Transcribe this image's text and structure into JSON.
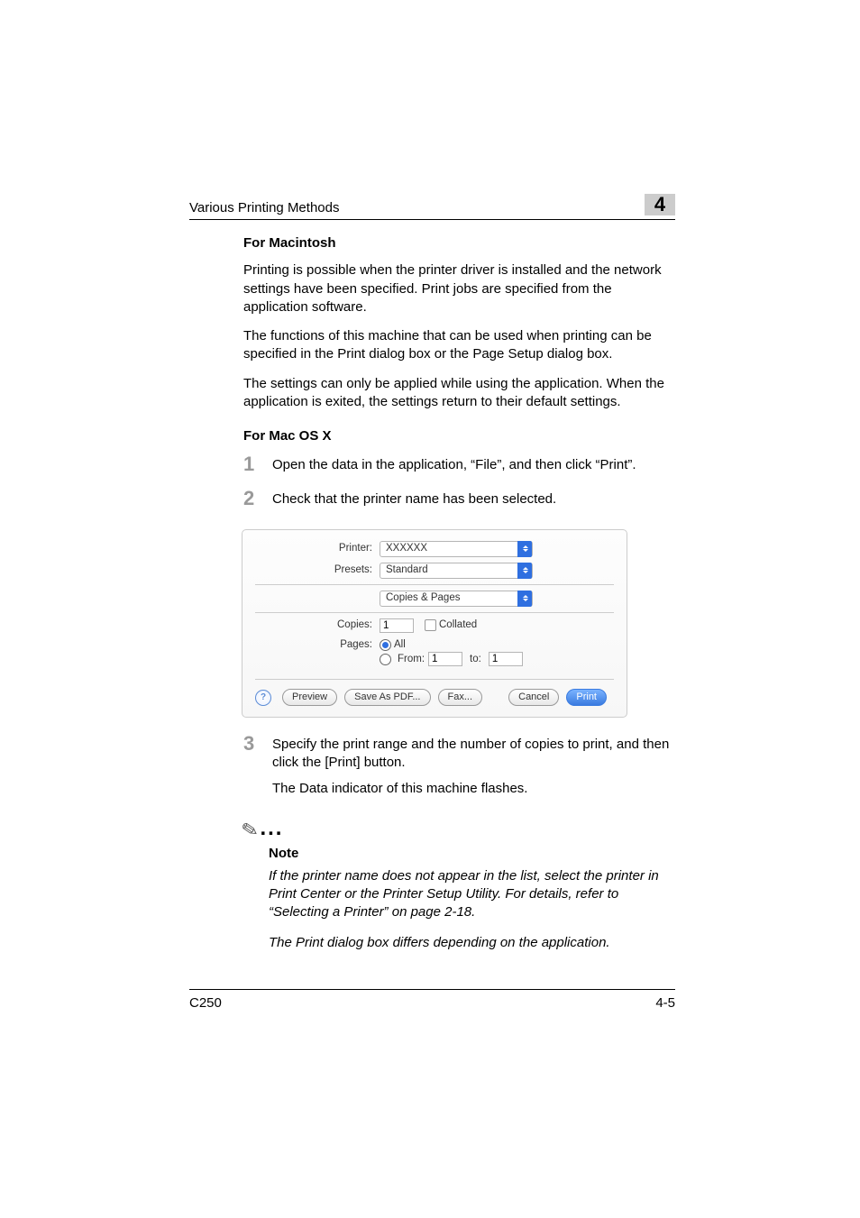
{
  "header": {
    "running_title": "Various Printing Methods",
    "chapter_number": "4"
  },
  "section_mac": {
    "heading": "For Macintosh",
    "p1": "Printing is possible when the printer driver is installed and the network settings have been specified. Print jobs are specified from the application software.",
    "p2": "The functions of this machine that can be used when printing can be specified in the Print dialog box or the Page Setup dialog box.",
    "p3": "The settings can only be applied while using the application. When the application is exited, the settings return to their default settings."
  },
  "section_osx": {
    "heading": "For Mac OS X",
    "steps": {
      "s1": {
        "num": "1",
        "text": "Open the data in the application, “File”, and then click “Print”."
      },
      "s2": {
        "num": "2",
        "text": "Check that the printer name has been selected."
      },
      "s3": {
        "num": "3",
        "text": "Specify the print range and the number of copies to print, and then click the [Print] button.",
        "sub": "The Data indicator of this machine flashes."
      }
    }
  },
  "dialog": {
    "printer_label": "Printer:",
    "printer_value": "XXXXXX",
    "presets_label": "Presets:",
    "presets_value": "Standard",
    "panel_value": "Copies & Pages",
    "copies_label": "Copies:",
    "copies_value": "1",
    "collated_label": "Collated",
    "pages_label": "Pages:",
    "pages_all": "All",
    "pages_from": "From:",
    "from_value": "1",
    "to_label": "to:",
    "to_value": "1",
    "help": "?",
    "btn_preview": "Preview",
    "btn_saveaspdf": "Save As PDF...",
    "btn_fax": "Fax...",
    "btn_cancel": "Cancel",
    "btn_print": "Print"
  },
  "note": {
    "heading": "Note",
    "body1": "If the printer name does not appear in the list, select the printer in Print Center or the Printer Setup Utility. For details, refer to “Selecting a Printer” on page 2-18.",
    "body2": "The Print dialog box differs depending on the application."
  },
  "footer": {
    "model": "C250",
    "pagenum": "4-5"
  }
}
